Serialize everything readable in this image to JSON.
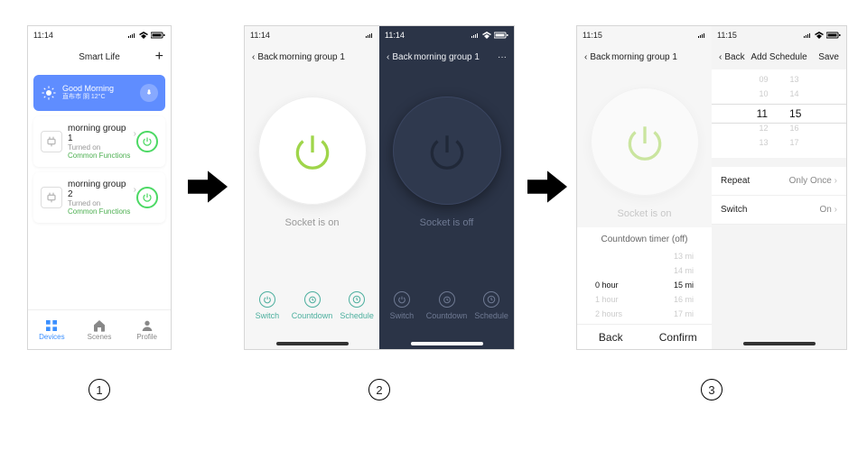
{
  "steps": [
    "1",
    "2",
    "3"
  ],
  "p1": {
    "time": "11:14",
    "title": "Smart Life",
    "add": "+",
    "banner": {
      "title": "Good Morning",
      "subtitle": "直布市  阴  12°C"
    },
    "devices": [
      {
        "name": "morning group 1",
        "status": "Turned on",
        "common": "Common Functions"
      },
      {
        "name": "morning group 2",
        "status": "Turned on",
        "common": "Common Functions"
      }
    ],
    "tabs": [
      {
        "label": "Devices",
        "active": true
      },
      {
        "label": "Scenes",
        "active": false
      },
      {
        "label": "Profile",
        "active": false
      }
    ]
  },
  "p2": {
    "left": {
      "time": "11:14",
      "back": "Back",
      "title": "morning group 1",
      "status": "Socket is on",
      "tabs": [
        "Switch",
        "Countdown",
        "Schedule"
      ]
    },
    "right": {
      "time": "11:14",
      "back": "Back",
      "title": "morning group 1",
      "status": "Socket is off",
      "tabs": [
        "Switch",
        "Countdown",
        "Schedule"
      ]
    }
  },
  "p3": {
    "left": {
      "time": "11:15",
      "back": "Back",
      "title": "morning group 1",
      "status": "Socket is on",
      "sheet_title": "Countdown timer (off)",
      "wheel_left": [
        "",
        "",
        "0 hour",
        "1 hour",
        "2 hours",
        ""
      ],
      "wheel_right": [
        "13 mi",
        "14 mi",
        "15 mi",
        "16 mi",
        "17 mi",
        ""
      ],
      "cancel": "Back",
      "confirm": "Confirm"
    },
    "right": {
      "time": "11:15",
      "back": "Back",
      "title": "Add Schedule",
      "save": "Save",
      "hours": [
        "09",
        "10",
        "11",
        "12",
        "13"
      ],
      "mins": [
        "13",
        "14",
        "15",
        "16",
        "17"
      ],
      "rows": [
        {
          "label": "Repeat",
          "value": "Only Once"
        },
        {
          "label": "Switch",
          "value": "On"
        }
      ]
    }
  }
}
